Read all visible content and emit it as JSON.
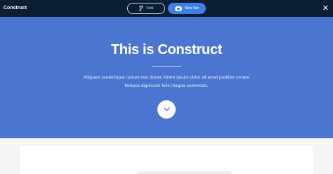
{
  "topbar": {
    "brand": "Construct",
    "fork_label": "Fork",
    "new_site_label": "New Site",
    "close_glyph": "✕",
    "icons": {
      "fork": "git-fork-icon",
      "new_site": "cloud-icon",
      "close": "close-icon"
    }
  },
  "hero": {
    "title": "This is Construct",
    "description": "Aliquam scelerisque rutrum nec donec lorem ipsum dolor sit amet porttitor ornare tempus dignissim felis magna commodo.",
    "scroll_icon": "chevron-down-icon"
  },
  "colors": {
    "topbar": "#0b1e33",
    "hero": "#4a76d1",
    "accent": "#3f7fe8",
    "page": "#f5f5f5"
  }
}
